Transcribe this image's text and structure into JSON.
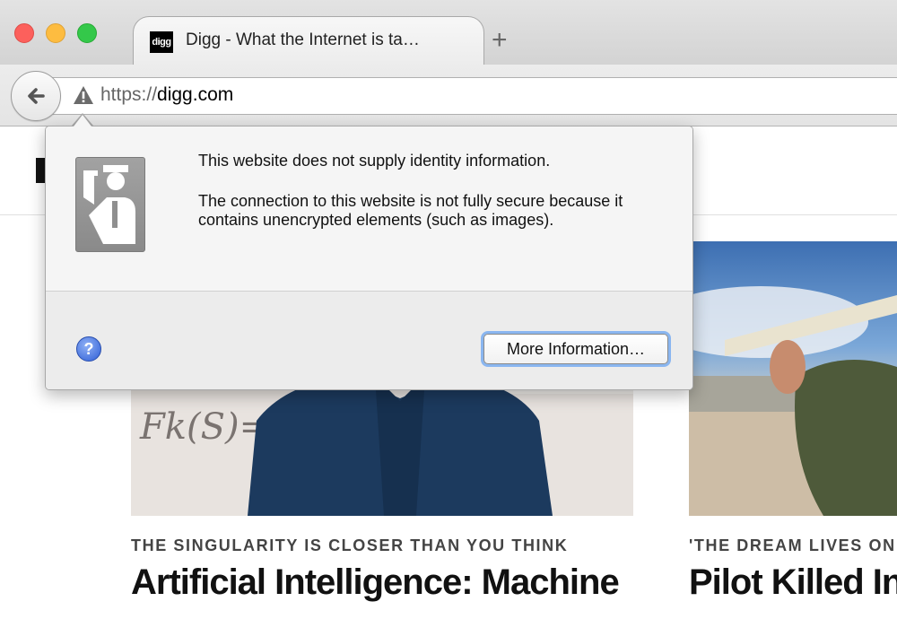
{
  "browser": {
    "tab_title": "Digg - What the Internet is ta…",
    "tab_favicon": "digg",
    "new_tab_glyph": "+",
    "url_scheme": "https://",
    "url_host": "digg.com"
  },
  "popup": {
    "message_primary": "This website does not supply identity information.",
    "message_secondary": "The connection to this website is not fully secure because it contains unencrypted elements (such as images).",
    "help_glyph": "?",
    "more_button": "More Information…"
  },
  "page": {
    "articles": [
      {
        "eyebrow": "THE SINGULARITY IS CLOSER THAN YOU THINK",
        "headline": "Artificial Intelligence: Machine"
      },
      {
        "eyebrow": "'THE DREAM LIVES ON",
        "headline": "Pilot Killed In"
      }
    ]
  },
  "colors": {
    "close": "#fc605c",
    "minimize": "#fdbc40",
    "maximize": "#34c84a",
    "focus_ring": "#8ab6f0",
    "help_blue": "#2e5ed6"
  }
}
